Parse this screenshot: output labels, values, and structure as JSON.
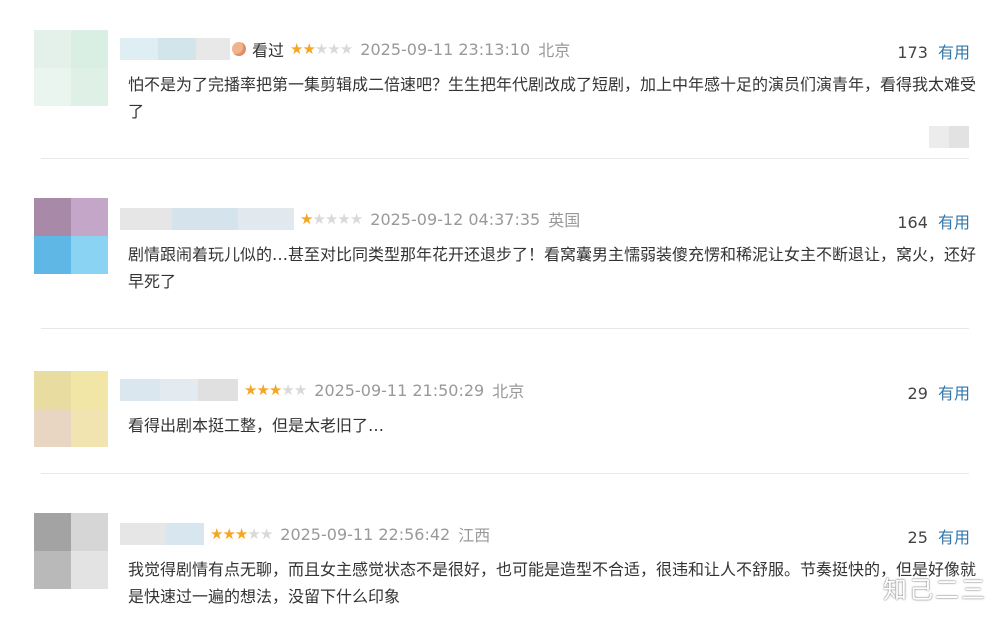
{
  "reviews": [
    {
      "avatar_colors": [
        "#e4f1ea",
        "#d9efe4",
        "#eaf5ef",
        "#dff0e7"
      ],
      "username_colors": [
        "#dfeef2",
        "#d1e5ea",
        "#e8e8e8"
      ],
      "tag": "看过",
      "rating": 2,
      "time": "2025-09-11 23:13:10",
      "location": "北京",
      "useful_count": "173",
      "useful_label": "有用",
      "content": "怕不是为了完播率把第一集剪辑成二倍速吧？生生把年代剧改成了短剧，加上中年感十足的演员们演青年，看得我太难受了"
    },
    {
      "avatar_colors": [
        "#a88aa8",
        "#c3a6c8",
        "#5fb7e6",
        "#8bd3f2"
      ],
      "username_colors": [
        "#e6e6e6",
        "#d4e3ec",
        "#e2e9ee"
      ],
      "tag": "",
      "rating": 1,
      "time": "2025-09-12 04:37:35",
      "location": "英国",
      "useful_count": "164",
      "useful_label": "有用",
      "content": "剧情跟闹着玩儿似的…甚至对比同类型那年花开还退步了！看窝囊男主懦弱装傻充愣和稀泥让女主不断退让，窝火，还好早死了"
    },
    {
      "avatar_colors": [
        "#e9dca0",
        "#f2e6a6",
        "#e8d6c2",
        "#f1e4b0"
      ],
      "username_colors": [
        "#dbe7ee",
        "#e3ebf1",
        "#e0e0e0"
      ],
      "tag": "",
      "rating": 3,
      "time": "2025-09-11 21:50:29",
      "location": "北京",
      "useful_count": "29",
      "useful_label": "有用",
      "content": "看得出剧本挺工整，但是太老旧了…"
    },
    {
      "avatar_colors": [
        "#a3a3a3",
        "#d6d6d6",
        "#b9b9b9",
        "#e3e3e3"
      ],
      "username_colors": [
        "#e6e6e6",
        "#d7e6ef",
        "#f0f0f0"
      ],
      "tag": "",
      "rating": 3,
      "time": "2025-09-11 22:56:42",
      "location": "江西",
      "useful_count": "25",
      "useful_label": "有用",
      "content": "我觉得剧情有点无聊，而且女主感觉状态不是很好，也可能是造型不合适，很违和让人不舒服。节奏挺快的，但是好像就是快速过一遍的想法，没留下什么印象"
    }
  ],
  "watermark": "知己二三",
  "colors": {
    "star_on": "#f5a623",
    "star_off": "#d9d9d9",
    "useful_link": "#3377aa",
    "meta_gray": "#999999"
  }
}
